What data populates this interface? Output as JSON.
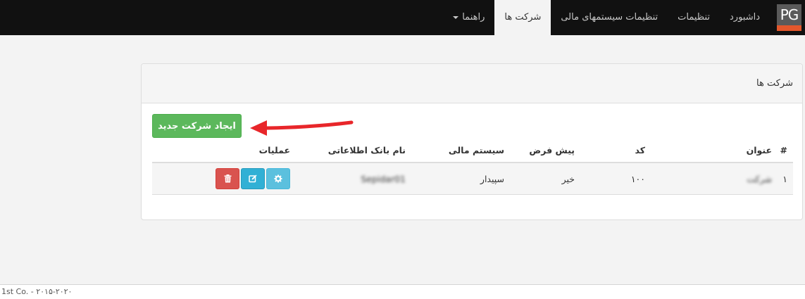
{
  "navbar": {
    "logo_text": "PG",
    "items": [
      {
        "label": "داشبورد"
      },
      {
        "label": "تنظیمات"
      },
      {
        "label": "تنظیمات سیستمهای مالی"
      },
      {
        "label": "شرکت ها"
      },
      {
        "label": "راهنما"
      }
    ],
    "active_label": "شرکت ها"
  },
  "panel": {
    "title": "شرکت ها",
    "create_button": "ایجاد شرکت جدید"
  },
  "table": {
    "headers": {
      "num": "#",
      "title": "عنوان",
      "code": "کد",
      "default": "پیش فرض",
      "system": "سیستم مالی",
      "database": "نام بانک اطلاعاتی",
      "operations": "عملیات"
    },
    "rows": [
      {
        "num": "۱",
        "title": "شرکت",
        "code": "۱۰۰",
        "default": "خیر",
        "system": "سپیدار",
        "database": "Sepidar01"
      }
    ]
  },
  "icons": {
    "settings": "gear-icon",
    "edit": "edit-icon",
    "delete": "trash-icon"
  },
  "colors": {
    "navbar_bg": "#111111",
    "create_button": "#5cb85c",
    "settings_button": "#5bc0de",
    "edit_button": "#31b0d5",
    "delete_button": "#d9534f",
    "annotation_arrow": "#e8262a"
  },
  "footer": {
    "text": "1st Co. - ۲۰۱۵-۲۰۲۰"
  }
}
